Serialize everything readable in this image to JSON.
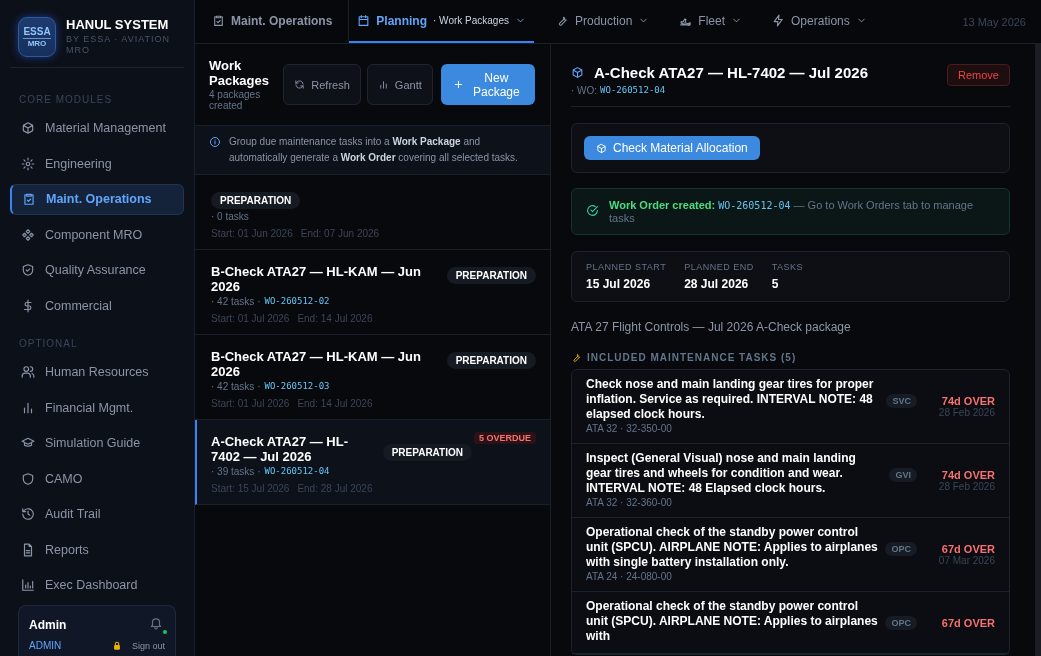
{
  "brand": {
    "logo_top": "ESSA",
    "logo_bottom": "MRO",
    "name": "HANUL SYSTEM",
    "subtitle": "BY ESSA · AVIATION MRO"
  },
  "sidebar": {
    "sections": [
      {
        "heading": "CORE MODULES",
        "items": [
          {
            "label": "Material Management",
            "selected": false
          },
          {
            "label": "Engineering",
            "selected": false
          },
          {
            "label": "Maint. Operations",
            "selected": true
          },
          {
            "label": "Component MRO",
            "selected": false
          },
          {
            "label": "Quality Assurance",
            "selected": false
          },
          {
            "label": "Commercial",
            "selected": false
          }
        ]
      },
      {
        "heading": "OPTIONAL",
        "items": [
          {
            "label": "Human Resources",
            "selected": false
          },
          {
            "label": "Financial Mgmt.",
            "selected": false
          },
          {
            "label": "Simulation Guide",
            "selected": false
          },
          {
            "label": "CAMO",
            "selected": false
          },
          {
            "label": "Audit Trail",
            "selected": false
          },
          {
            "label": "Reports",
            "selected": false
          },
          {
            "label": "Exec Dashboard",
            "selected": false
          }
        ]
      }
    ],
    "user": {
      "name": "Admin",
      "role": "ADMIN",
      "sign_out": "Sign out",
      "notification_dot": true
    }
  },
  "topnav": {
    "items": [
      {
        "label": "Maint. Operations",
        "dropdown": false,
        "selected": false
      },
      {
        "label": "Planning",
        "sub": "· Work Packages",
        "dropdown": true,
        "selected": true
      },
      {
        "label": "Production",
        "dropdown": true,
        "selected": false
      },
      {
        "label": "Fleet",
        "dropdown": true,
        "selected": false
      },
      {
        "label": "Operations",
        "dropdown": true,
        "selected": false
      }
    ],
    "date": "13 May 2026"
  },
  "list": {
    "title": "Work Packages",
    "count": "4 packages created",
    "buttons": [
      {
        "label": "Refresh",
        "kind": "refresh"
      },
      {
        "label": "Gantt",
        "kind": "gantt"
      },
      {
        "label": "New Package",
        "kind": "primary"
      }
    ],
    "info": "Group due maintenance tasks into a **Work Package** and automatically generate a **Work Order** covering all selected tasks.",
    "packages": [
      {
        "status": "PREPARATION",
        "tasks": "· 0 tasks",
        "start": "Start: 01 Jun 2026",
        "end": "End: 07 Jun 2026",
        "selected": false
      },
      {
        "title": "B-Check ATA27 — HL-KAM — Jun 2026",
        "status": "PREPARATION",
        "tasks": "· 42 tasks ·",
        "wo": "WO-260512-02",
        "start": "Start: 01 Jul 2026",
        "end": "End: 14 Jul 2026",
        "selected": false
      },
      {
        "title": "B-Check ATA27 — HL-KAM — Jun 2026",
        "status": "PREPARATION",
        "tasks": "· 42 tasks ·",
        "wo": "WO-260512-03",
        "start": "Start: 01 Jul 2026",
        "end": "End: 14 Jul 2026",
        "selected": false
      },
      {
        "title": "A-Check ATA27 — HL-7402 — Jul 2026",
        "status": "PREPARATION",
        "tasks": "· 39 tasks ·",
        "wo": "WO-260512-04",
        "start": "Start: 15 Jul 2026",
        "end": "End: 28 Jul 2026",
        "overdue": "5 OVERDUE",
        "selected": true
      }
    ]
  },
  "detail": {
    "title": "A-Check ATA27 — HL-7402 — Jul 2026",
    "wo_label": "· WO:",
    "wo": "WO-260512-04",
    "remove": "Remove",
    "allocation_button": "Check Material Allocation",
    "success": {
      "label": "Work Order created:",
      "wo": "WO-260512-04",
      "text": "— Go to Work Orders tab to manage tasks"
    },
    "stats": [
      {
        "label": "PLANNED START",
        "value": "15 Jul 2026"
      },
      {
        "label": "PLANNED END",
        "value": "28 Jul 2026"
      },
      {
        "label": "TASKS",
        "value": "5"
      }
    ],
    "description": "ATA 27 Flight Controls — Jul 2026 A-Check package",
    "tasks_heading": "INCLUDED MAINTENANCE TASKS (5)",
    "tasks": [
      {
        "title": "Check nose and main landing gear tires for proper inflation. Service as required. INTERVAL NOTE: 48 elapsed clock hours.",
        "ref": "ATA 32 · 32-350-00",
        "code": "SVC",
        "over": "74d OVER",
        "due": "28 Feb 2026"
      },
      {
        "title": "Inspect (General Visual) nose and main landing gear tires and wheels for condition and wear. INTERVAL NOTE: 48 Elapsed clock hours.",
        "ref": "ATA 32 · 32-360-00",
        "code": "GVI",
        "over": "74d OVER",
        "due": "28 Feb 2026"
      },
      {
        "title": "Operational check of the standby power control unit (SPCU). AIRPLANE NOTE: Applies to airplanes with single battery installation only.",
        "ref": "ATA 24 · 24-080-00",
        "code": "OPC",
        "over": "67d OVER",
        "due": "07 Mar 2026"
      },
      {
        "title": "Operational check of the standby power control unit (SPCU). AIRPLANE NOTE: Applies to airplanes with",
        "code": "OPC",
        "over": "67d OVER"
      }
    ]
  }
}
